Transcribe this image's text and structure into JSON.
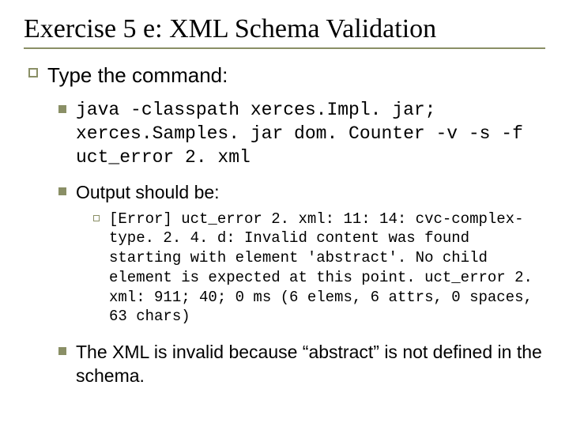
{
  "title": "Exercise 5 e: XML Schema Validation",
  "lvl1": {
    "text": "Type the command:"
  },
  "lvl2_items": [
    {
      "mono": true,
      "text": "java -classpath xerces.Impl. jar; xerces.Samples. jar dom. Counter -v -s -f uct_error 2. xml"
    },
    {
      "mono": false,
      "text": "Output should be:"
    },
    {
      "mono": false,
      "text": "The XML is invalid because “abstract” is not defined in the schema."
    }
  ],
  "lvl3": {
    "text": "[Error] uct_error 2. xml: 11: 14: cvc-complex-type. 2. 4. d: Invalid content was found starting with element 'abstract'. No child element is expected at this point. uct_error 2. xml: 911; 40; 0 ms (6 elems, 6 attrs, 0 spaces, 63 chars)"
  }
}
